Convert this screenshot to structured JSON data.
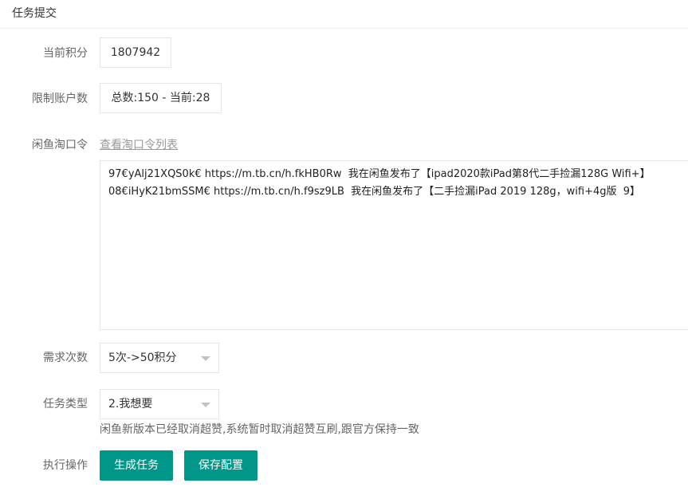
{
  "panel": {
    "title": "任务提交"
  },
  "form": {
    "points": {
      "label": "当前积分",
      "value": "1807942"
    },
    "account_limit": {
      "label": "限制账户数",
      "value": "总数:150 - 当前:28"
    },
    "password": {
      "label": "闲鱼淘口令",
      "link_text": "查看淘口令列表",
      "lines": [
        "97€yAlj21XQS0k€ https://m.tb.cn/h.fkHB0Rw  我在闲鱼发布了【ipad2020款iPad第8代二手捡漏128G Wifi+】",
        "08€iHyK21bmSSM€ https://m.tb.cn/h.f9sz9LB  我在闲鱼发布了【二手捡漏iPad 2019 128g，wifi+4g版  9】"
      ]
    },
    "demand_count": {
      "label": "需求次数",
      "selected": "5次->50积分"
    },
    "task_type": {
      "label": "任务类型",
      "selected": "2.我想要",
      "note": "闲鱼新版本已经取消超赞,系统暂时取消超赞互刷,跟官方保持一致"
    },
    "actions": {
      "label": "执行操作",
      "generate_button": "生成任务",
      "save_button": "保存配置"
    }
  },
  "colors": {
    "primary": "#009688",
    "border": "#e6e6e6",
    "label": "#666666"
  }
}
